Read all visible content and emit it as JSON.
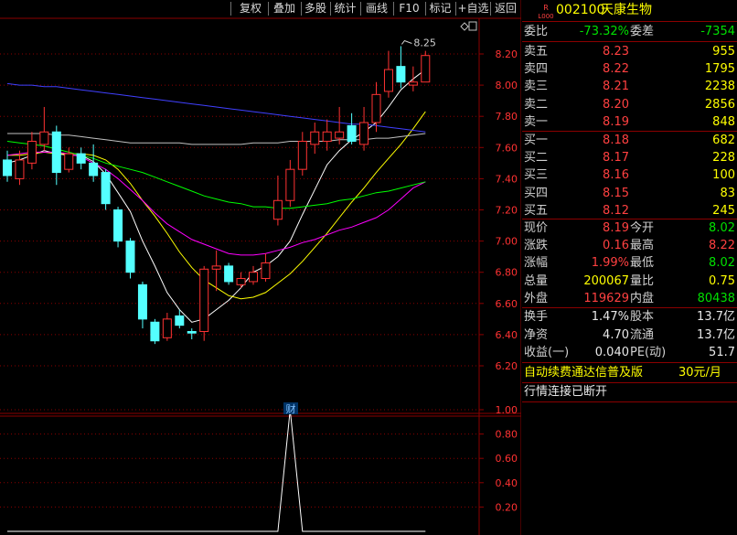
{
  "toolbar": {
    "buttons": [
      "复权",
      "叠加",
      "多股",
      "统计",
      "画线",
      "F10",
      "标记",
      "+自选",
      "返回"
    ]
  },
  "chart": {
    "price_axis_labels": [
      "8.20",
      "8.00",
      "7.80",
      "7.60",
      "7.40",
      "7.20",
      "7.00",
      "6.80",
      "6.60",
      "6.40",
      "6.20"
    ],
    "indicator_axis_labels": [
      "1.00",
      "0.80",
      "0.60",
      "0.40",
      "0.20"
    ],
    "max_marker_label": "8.25",
    "finance_marker": "财"
  },
  "colors": {
    "up": "#ff3232",
    "down": "#54ffff",
    "ma5": "#ffffff",
    "ma10": "#ffff00",
    "ma20": "#ff00ff",
    "ma30": "#00ff00",
    "ma60": "#4040ff",
    "ma120": "#c0c0c0"
  },
  "chart_data": {
    "type": "candlestick",
    "title": "",
    "ylim": [
      6.2,
      8.3
    ],
    "candles": [
      {
        "o": 7.52,
        "c": 7.42,
        "h": 7.58,
        "l": 7.38
      },
      {
        "o": 7.4,
        "c": 7.52,
        "h": 7.58,
        "l": 7.36
      },
      {
        "o": 7.5,
        "c": 7.64,
        "h": 7.7,
        "l": 7.46
      },
      {
        "o": 7.62,
        "c": 7.7,
        "h": 7.86,
        "l": 7.58
      },
      {
        "o": 7.7,
        "c": 7.44,
        "h": 7.74,
        "l": 7.36
      },
      {
        "o": 7.46,
        "c": 7.56,
        "h": 7.6,
        "l": 7.44
      },
      {
        "o": 7.56,
        "c": 7.5,
        "h": 7.6,
        "l": 7.46
      },
      {
        "o": 7.5,
        "c": 7.42,
        "h": 7.62,
        "l": 7.38
      },
      {
        "o": 7.44,
        "c": 7.24,
        "h": 7.46,
        "l": 7.2
      },
      {
        "o": 7.2,
        "c": 7.0,
        "h": 7.22,
        "l": 6.96
      },
      {
        "o": 7.0,
        "c": 6.8,
        "h": 7.02,
        "l": 6.76
      },
      {
        "o": 6.72,
        "c": 6.5,
        "h": 6.74,
        "l": 6.44
      },
      {
        "o": 6.48,
        "c": 6.36,
        "h": 6.5,
        "l": 6.34
      },
      {
        "o": 6.38,
        "c": 6.5,
        "h": 6.54,
        "l": 6.36
      },
      {
        "o": 6.52,
        "c": 6.46,
        "h": 6.56,
        "l": 6.44
      },
      {
        "o": 6.42,
        "c": 6.41,
        "h": 6.44,
        "l": 6.37
      },
      {
        "o": 6.42,
        "c": 6.82,
        "h": 6.84,
        "l": 6.36
      },
      {
        "o": 6.82,
        "c": 6.84,
        "h": 6.94,
        "l": 6.68
      },
      {
        "o": 6.84,
        "c": 6.74,
        "h": 6.86,
        "l": 6.72
      },
      {
        "o": 6.72,
        "c": 6.76,
        "h": 6.8,
        "l": 6.7
      },
      {
        "o": 6.74,
        "c": 6.8,
        "h": 6.84,
        "l": 6.72
      },
      {
        "o": 6.76,
        "c": 6.86,
        "h": 6.92,
        "l": 6.74
      },
      {
        "o": 7.14,
        "c": 7.26,
        "h": 7.42,
        "l": 7.1
      },
      {
        "o": 7.26,
        "c": 7.46,
        "h": 7.52,
        "l": 7.22
      },
      {
        "o": 7.46,
        "c": 7.64,
        "h": 7.7,
        "l": 7.42
      },
      {
        "o": 7.62,
        "c": 7.7,
        "h": 7.76,
        "l": 7.56
      },
      {
        "o": 7.64,
        "c": 7.7,
        "h": 7.78,
        "l": 7.58
      },
      {
        "o": 7.66,
        "c": 7.7,
        "h": 7.86,
        "l": 7.62
      },
      {
        "o": 7.74,
        "c": 7.64,
        "h": 7.82,
        "l": 7.62
      },
      {
        "o": 7.62,
        "c": 7.76,
        "h": 7.86,
        "l": 7.58
      },
      {
        "o": 7.76,
        "c": 7.94,
        "h": 8.02,
        "l": 7.7
      },
      {
        "o": 7.96,
        "c": 8.1,
        "h": 8.22,
        "l": 7.92
      },
      {
        "o": 8.12,
        "c": 8.02,
        "h": 8.25,
        "l": 7.98
      },
      {
        "o": 8.0,
        "c": 8.02,
        "h": 8.12,
        "l": 7.96
      },
      {
        "o": 8.02,
        "c": 8.19,
        "h": 8.22,
        "l": 8.02
      }
    ],
    "ma_lines": [
      {
        "name": "MA5",
        "color": "#ffffff",
        "values": [
          7.5,
          7.52,
          7.55,
          7.58,
          7.56,
          7.55,
          7.55,
          7.51,
          7.43,
          7.31,
          7.19,
          7.0,
          6.84,
          6.67,
          6.56,
          6.48,
          6.5,
          6.56,
          6.62,
          6.7,
          6.8,
          6.84,
          6.9,
          7.0,
          7.17,
          7.33,
          7.49,
          7.58,
          7.65,
          7.7,
          7.76,
          7.86,
          7.97,
          8.04,
          8.1
        ]
      },
      {
        "name": "MA10",
        "color": "#ffff00",
        "values": [
          7.55,
          7.55,
          7.56,
          7.57,
          7.56,
          7.56,
          7.56,
          7.55,
          7.52,
          7.46,
          7.37,
          7.26,
          7.16,
          7.05,
          6.93,
          6.83,
          6.75,
          6.7,
          6.65,
          6.63,
          6.64,
          6.67,
          6.73,
          6.79,
          6.87,
          6.96,
          7.05,
          7.15,
          7.25,
          7.34,
          7.44,
          7.53,
          7.62,
          7.72,
          7.83
        ]
      },
      {
        "name": "MA20",
        "color": "#ff00ff",
        "values": [
          7.55,
          7.56,
          7.57,
          7.57,
          7.57,
          7.56,
          7.54,
          7.5,
          7.46,
          7.4,
          7.33,
          7.26,
          7.18,
          7.11,
          7.06,
          7.01,
          6.98,
          6.95,
          6.92,
          6.91,
          6.91,
          6.92,
          6.94,
          6.96,
          6.99,
          7.01,
          7.04,
          7.07,
          7.09,
          7.12,
          7.15,
          7.2,
          7.27,
          7.34,
          7.38
        ]
      },
      {
        "name": "MA30",
        "color": "#00ff00",
        "values": [
          7.64,
          7.63,
          7.62,
          7.61,
          7.59,
          7.57,
          7.55,
          7.53,
          7.5,
          7.48,
          7.46,
          7.44,
          7.41,
          7.38,
          7.35,
          7.32,
          7.29,
          7.27,
          7.25,
          7.24,
          7.22,
          7.22,
          7.21,
          7.21,
          7.22,
          7.23,
          7.24,
          7.26,
          7.27,
          7.29,
          7.31,
          7.32,
          7.34,
          7.36,
          7.38
        ]
      },
      {
        "name": "MA60",
        "color": "#4040ff",
        "values": [
          8.01,
          8.0,
          8.0,
          7.99,
          7.99,
          7.98,
          7.97,
          7.96,
          7.95,
          7.94,
          7.93,
          7.92,
          7.91,
          7.9,
          7.89,
          7.88,
          7.87,
          7.86,
          7.85,
          7.84,
          7.83,
          7.82,
          7.81,
          7.8,
          7.79,
          7.78,
          7.77,
          7.76,
          7.75,
          7.75,
          7.74,
          7.73,
          7.72,
          7.71,
          7.7
        ]
      },
      {
        "name": "MA120",
        "color": "#c0c0c0",
        "values": [
          7.69,
          7.69,
          7.69,
          7.69,
          7.68,
          7.68,
          7.67,
          7.66,
          7.65,
          7.64,
          7.63,
          7.63,
          7.63,
          7.63,
          7.63,
          7.62,
          7.62,
          7.62,
          7.62,
          7.62,
          7.63,
          7.63,
          7.63,
          7.64,
          7.64,
          7.64,
          7.64,
          7.65,
          7.65,
          7.65,
          7.66,
          7.66,
          7.67,
          7.68,
          7.69
        ]
      }
    ],
    "indicator": {
      "ylim": [
        0,
        1.1
      ],
      "values": [
        0,
        0,
        0,
        0,
        0,
        0,
        0,
        0,
        0,
        0,
        0,
        0,
        0,
        0,
        0,
        0,
        0,
        0,
        0,
        0,
        0,
        0,
        0,
        1.0,
        0,
        0,
        0,
        0,
        0,
        0,
        0,
        0,
        0,
        0,
        0
      ]
    }
  },
  "panel": {
    "code": "002100",
    "name": "天康生物",
    "badge_top": "R",
    "badge_bottom": "L000",
    "weibi_label": "委比",
    "weibi_value": "-73.32%",
    "weicha_label": "委差",
    "weicha_value": "-7354",
    "sell": [
      {
        "label": "卖五",
        "price": "8.23",
        "vol": "955"
      },
      {
        "label": "卖四",
        "price": "8.22",
        "vol": "1795"
      },
      {
        "label": "卖三",
        "price": "8.21",
        "vol": "2238"
      },
      {
        "label": "卖二",
        "price": "8.20",
        "vol": "2856"
      },
      {
        "label": "卖一",
        "price": "8.19",
        "vol": "848"
      }
    ],
    "buy": [
      {
        "label": "买一",
        "price": "8.18",
        "vol": "682"
      },
      {
        "label": "买二",
        "price": "8.17",
        "vol": "228"
      },
      {
        "label": "买三",
        "price": "8.16",
        "vol": "100"
      },
      {
        "label": "买四",
        "price": "8.15",
        "vol": "83"
      },
      {
        "label": "买五",
        "price": "8.12",
        "vol": "245"
      }
    ],
    "quote": [
      {
        "l1": "现价",
        "v1": "8.19",
        "c1": "red",
        "l2": "今开",
        "v2": "8.02",
        "c2": "green"
      },
      {
        "l1": "涨跌",
        "v1": "0.16",
        "c1": "red",
        "l2": "最高",
        "v2": "8.22",
        "c2": "red"
      },
      {
        "l1": "涨幅",
        "v1": "1.99%",
        "c1": "red",
        "l2": "最低",
        "v2": "8.02",
        "c2": "green"
      },
      {
        "l1": "总量",
        "v1": "200067",
        "c1": "yellow",
        "l2": "量比",
        "v2": "0.75",
        "c2": "yellow"
      },
      {
        "l1": "外盘",
        "v1": "119629",
        "c1": "red",
        "l2": "内盘",
        "v2": "80438",
        "c2": "green"
      }
    ],
    "fin": [
      {
        "l1": "换手",
        "v1": "1.47%",
        "l2": "股本",
        "v2": "13.7亿"
      },
      {
        "l1": "净资",
        "v1": "4.70",
        "l2": "流通",
        "v2": "13.7亿"
      },
      {
        "l1": "收益(一)",
        "v1": "0.040",
        "l2": "PE(动)",
        "v2": "51.7"
      }
    ],
    "ad_text": "自动续费通达信普及版",
    "ad_price": "30元/月",
    "status": "行情连接已断开"
  }
}
